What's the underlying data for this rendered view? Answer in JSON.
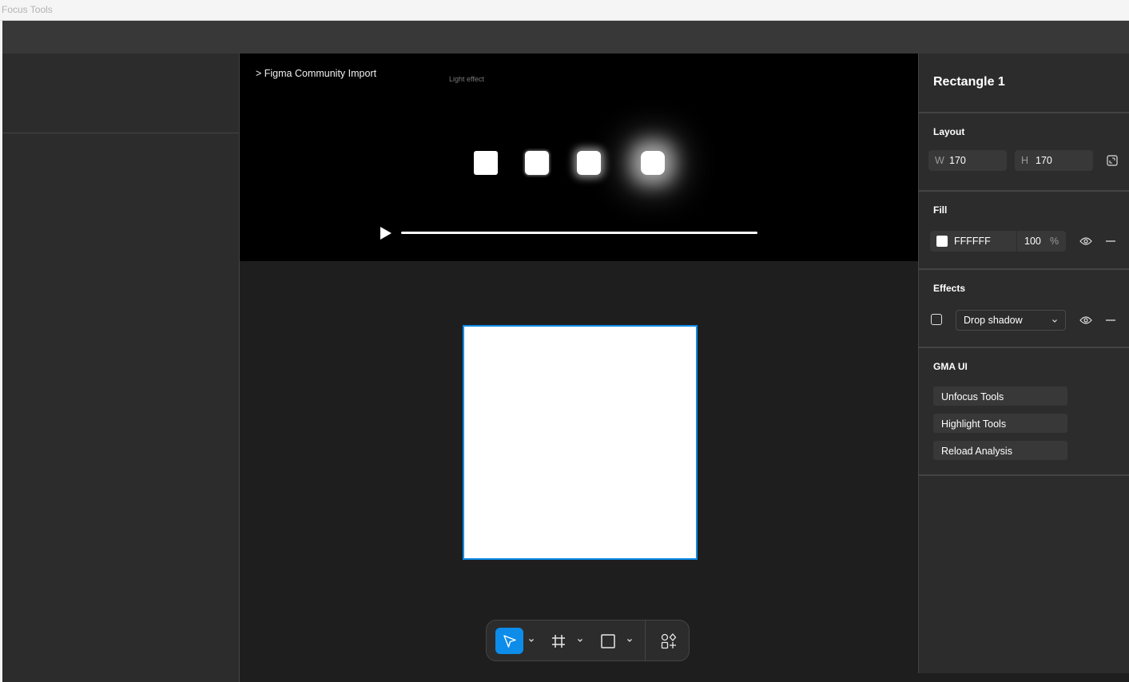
{
  "window": {
    "title": "Focus Tools"
  },
  "video": {
    "breadcrumb": "> Figma Community Import",
    "caption": "Light effect"
  },
  "toolbar": {
    "tools": [
      "move-tool",
      "frame-tool",
      "shape-tool",
      "actions-tool"
    ],
    "active": "move-tool",
    "accent": "#0d8ce9"
  },
  "properties": {
    "title": "Rectangle 1",
    "layout": {
      "label": "Layout",
      "width_prefix": "W",
      "width": "170",
      "height_prefix": "H",
      "height": "170"
    },
    "fill": {
      "label": "Fill",
      "hex": "FFFFFF",
      "opacity": "100",
      "unit": "%",
      "swatch_color": "#ffffff"
    },
    "effects": {
      "label": "Effects",
      "type": "Drop shadow"
    },
    "plugin": {
      "label": "GMA UI",
      "buttons": [
        "Unfocus Tools",
        "Highlight Tools",
        "Reload Analysis"
      ]
    }
  },
  "selection_color": "#0d8ce9"
}
